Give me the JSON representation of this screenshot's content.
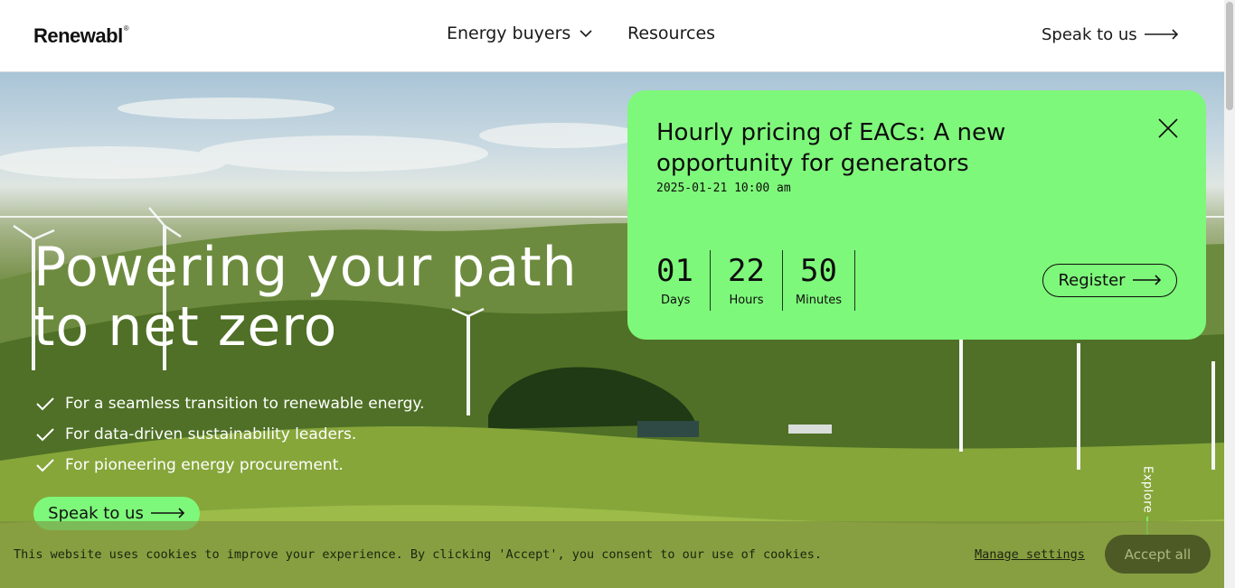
{
  "header": {
    "logo": "Renewabl",
    "logo_mark": "®",
    "nav": [
      {
        "label": "Energy buyers"
      },
      {
        "label": "Resources"
      }
    ],
    "cta_label": "Speak to us"
  },
  "hero": {
    "title": "Powering your path to net zero",
    "bullets": [
      "For a seamless transition to renewable energy.",
      "For data-driven sustainability leaders.",
      "For pioneering energy procurement."
    ],
    "cta_label": "Speak to us",
    "explore_label": "Explore"
  },
  "promo": {
    "title": "Hourly pricing of EACs: A new opportunity for generators",
    "datetime": "2025-01-21 10:00 am",
    "countdown": [
      {
        "value": "01",
        "label": "Days"
      },
      {
        "value": "22",
        "label": "Hours"
      },
      {
        "value": "50",
        "label": "Minutes"
      }
    ],
    "register_label": "Register"
  },
  "cookie": {
    "text": "This website uses cookies to improve your experience. By clicking 'Accept', you consent to our use of cookies.",
    "manage_label": "Manage settings",
    "accept_label": "Accept all"
  },
  "colors": {
    "accent_green": "#7ef87a",
    "text_dark": "#0d0d0d"
  },
  "icons": {
    "chevron": "chevron-down-icon",
    "arrow": "arrow-right-icon",
    "close": "close-icon",
    "check": "check-icon",
    "explore": "arrow-down-icon"
  }
}
